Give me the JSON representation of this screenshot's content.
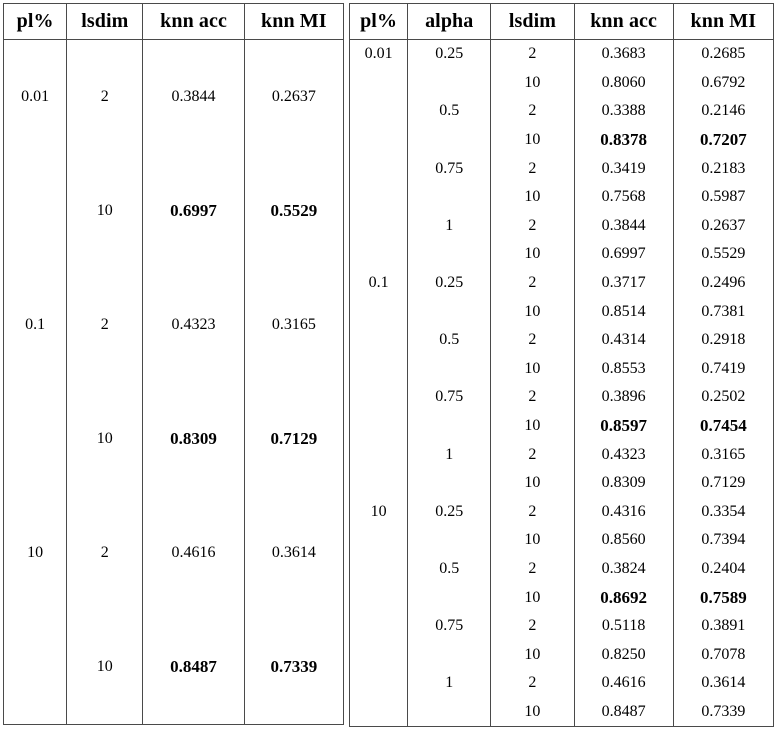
{
  "left_table": {
    "headers": [
      "pl%",
      "lsdim",
      "knn acc",
      "knn MI"
    ],
    "rows": [
      {
        "pl": "0.01",
        "lsdim": "2",
        "knn_acc": "0.3844",
        "knn_mi": "0.2637",
        "bold": false
      },
      {
        "pl": "",
        "lsdim": "10",
        "knn_acc": "0.6997",
        "knn_mi": "0.5529",
        "bold": true
      },
      {
        "pl": "0.1",
        "lsdim": "2",
        "knn_acc": "0.4323",
        "knn_mi": "0.3165",
        "bold": false
      },
      {
        "pl": "",
        "lsdim": "10",
        "knn_acc": "0.8309",
        "knn_mi": "0.7129",
        "bold": true
      },
      {
        "pl": "10",
        "lsdim": "2",
        "knn_acc": "0.4616",
        "knn_mi": "0.3614",
        "bold": false
      },
      {
        "pl": "",
        "lsdim": "10",
        "knn_acc": "0.8487",
        "knn_mi": "0.7339",
        "bold": true
      }
    ]
  },
  "right_table": {
    "headers": [
      "pl%",
      "alpha",
      "lsdim",
      "knn acc",
      "knn MI"
    ],
    "rows": [
      {
        "pl": "0.01",
        "alpha": "0.25",
        "lsdim": "2",
        "knn_acc": "0.3683",
        "knn_mi": "0.2685",
        "bold": false
      },
      {
        "pl": "",
        "alpha": "",
        "lsdim": "10",
        "knn_acc": "0.8060",
        "knn_mi": "0.6792",
        "bold": false
      },
      {
        "pl": "",
        "alpha": "0.5",
        "lsdim": "2",
        "knn_acc": "0.3388",
        "knn_mi": "0.2146",
        "bold": false
      },
      {
        "pl": "",
        "alpha": "",
        "lsdim": "10",
        "knn_acc": "0.8378",
        "knn_mi": "0.7207",
        "bold": true
      },
      {
        "pl": "",
        "alpha": "0.75",
        "lsdim": "2",
        "knn_acc": "0.3419",
        "knn_mi": "0.2183",
        "bold": false
      },
      {
        "pl": "",
        "alpha": "",
        "lsdim": "10",
        "knn_acc": "0.7568",
        "knn_mi": "0.5987",
        "bold": false
      },
      {
        "pl": "",
        "alpha": "1",
        "lsdim": "2",
        "knn_acc": "0.3844",
        "knn_mi": "0.2637",
        "bold": false
      },
      {
        "pl": "",
        "alpha": "",
        "lsdim": "10",
        "knn_acc": "0.6997",
        "knn_mi": "0.5529",
        "bold": false
      },
      {
        "pl": "0.1",
        "alpha": "0.25",
        "lsdim": "2",
        "knn_acc": "0.3717",
        "knn_mi": "0.2496",
        "bold": false
      },
      {
        "pl": "",
        "alpha": "",
        "lsdim": "10",
        "knn_acc": "0.8514",
        "knn_mi": "0.7381",
        "bold": false
      },
      {
        "pl": "",
        "alpha": "0.5",
        "lsdim": "2",
        "knn_acc": "0.4314",
        "knn_mi": "0.2918",
        "bold": false
      },
      {
        "pl": "",
        "alpha": "",
        "lsdim": "10",
        "knn_acc": "0.8553",
        "knn_mi": "0.7419",
        "bold": false
      },
      {
        "pl": "",
        "alpha": "0.75",
        "lsdim": "2",
        "knn_acc": "0.3896",
        "knn_mi": "0.2502",
        "bold": false
      },
      {
        "pl": "",
        "alpha": "",
        "lsdim": "10",
        "knn_acc": "0.8597",
        "knn_mi": "0.7454",
        "bold": true
      },
      {
        "pl": "",
        "alpha": "1",
        "lsdim": "2",
        "knn_acc": "0.4323",
        "knn_mi": "0.3165",
        "bold": false
      },
      {
        "pl": "",
        "alpha": "",
        "lsdim": "10",
        "knn_acc": "0.8309",
        "knn_mi": "0.7129",
        "bold": false
      },
      {
        "pl": "10",
        "alpha": "0.25",
        "lsdim": "2",
        "knn_acc": "0.4316",
        "knn_mi": "0.3354",
        "bold": false
      },
      {
        "pl": "",
        "alpha": "",
        "lsdim": "10",
        "knn_acc": "0.8560",
        "knn_mi": "0.7394",
        "bold": false
      },
      {
        "pl": "",
        "alpha": "0.5",
        "lsdim": "2",
        "knn_acc": "0.3824",
        "knn_mi": "0.2404",
        "bold": false
      },
      {
        "pl": "",
        "alpha": "",
        "lsdim": "10",
        "knn_acc": "0.8692",
        "knn_mi": "0.7589",
        "bold": true
      },
      {
        "pl": "",
        "alpha": "0.75",
        "lsdim": "2",
        "knn_acc": "0.5118",
        "knn_mi": "0.3891",
        "bold": false
      },
      {
        "pl": "",
        "alpha": "",
        "lsdim": "10",
        "knn_acc": "0.8250",
        "knn_mi": "0.7078",
        "bold": false
      },
      {
        "pl": "",
        "alpha": "1",
        "lsdim": "2",
        "knn_acc": "0.4616",
        "knn_mi": "0.3614",
        "bold": false
      },
      {
        "pl": "",
        "alpha": "",
        "lsdim": "10",
        "knn_acc": "0.8487",
        "knn_mi": "0.7339",
        "bold": false
      }
    ]
  },
  "style": {
    "rule_color": "#4a4a4a",
    "text_color": "#000000",
    "background": "#ffffff"
  }
}
